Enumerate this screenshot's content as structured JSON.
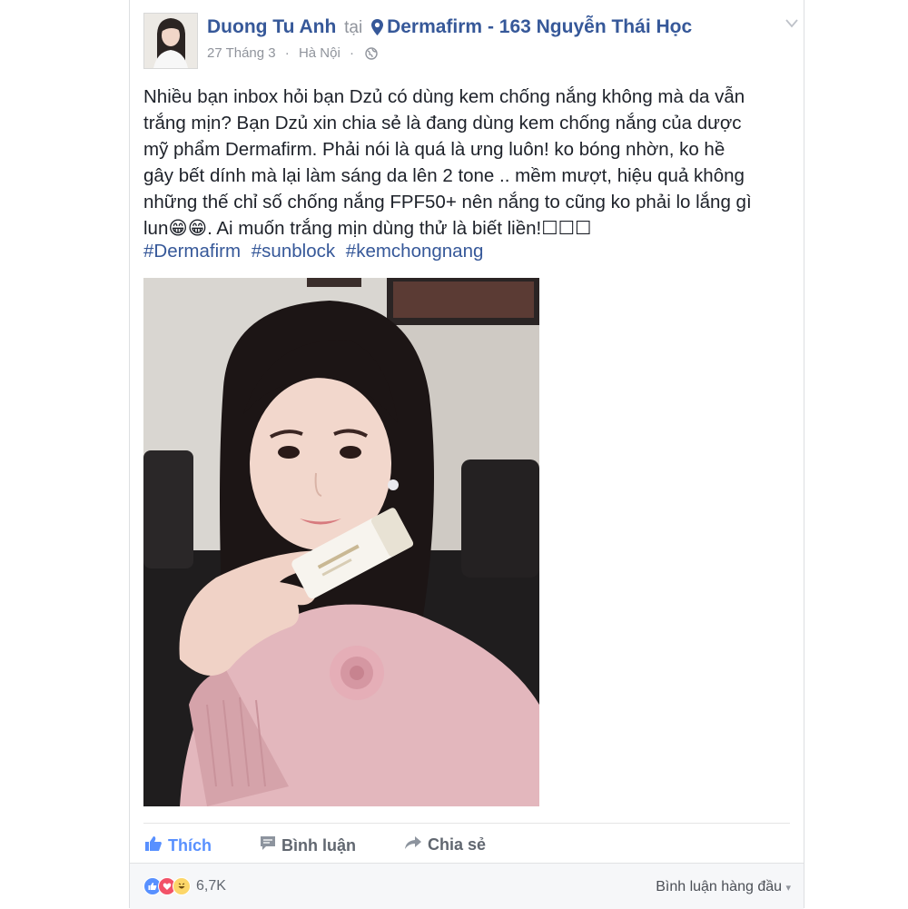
{
  "post": {
    "author": "Duong Tu Anh",
    "at_word": "tại",
    "place": "Dermafirm - 163 Nguyễn Thái Học",
    "date": "27 Tháng 3",
    "separator": "·",
    "city": "Hà Nội",
    "privacy_icon": "globe-icon",
    "text_lines": [
      "Nhiều bạn inbox hỏi bạn Dzủ có dùng kem chống nắng không mà da vẫn",
      "trắng mịn? Bạn Dzủ xin chia sẻ là đang dùng kem chống nắng của dược",
      "mỹ phẩm Dermafirm. Phải nói là quá là ưng luôn! ko bóng nhờn, ko hề",
      "gây bết dính mà lại làm sáng da lên 2 tone .. mềm mượt, hiệu quả không",
      "những thế chỉ số chống nắng FPF50+ nên nắng to cũng ko phải lo lắng gì",
      "lun😁😁. Ai muốn trắng mịn dùng thử là biết liền!☐☐☐"
    ],
    "hashtags": [
      "#Dermafirm",
      "#sunblock",
      "#kemchongnang"
    ]
  },
  "actions": {
    "like": "Thích",
    "comment": "Bình luận",
    "share": "Chia sẻ"
  },
  "footer": {
    "reaction_count": "6,7K",
    "reaction_icons": [
      "like-reaction-icon",
      "love-reaction-icon",
      "haha-reaction-icon"
    ],
    "top_comments": "Bình luận hàng đầu",
    "top_comments_arrow": "▾"
  },
  "colors": {
    "link": "#365899",
    "meta": "#90949c",
    "like_blue": "#5890ff",
    "love_red": "#f25268",
    "haha_yellow": "#fcd669"
  }
}
